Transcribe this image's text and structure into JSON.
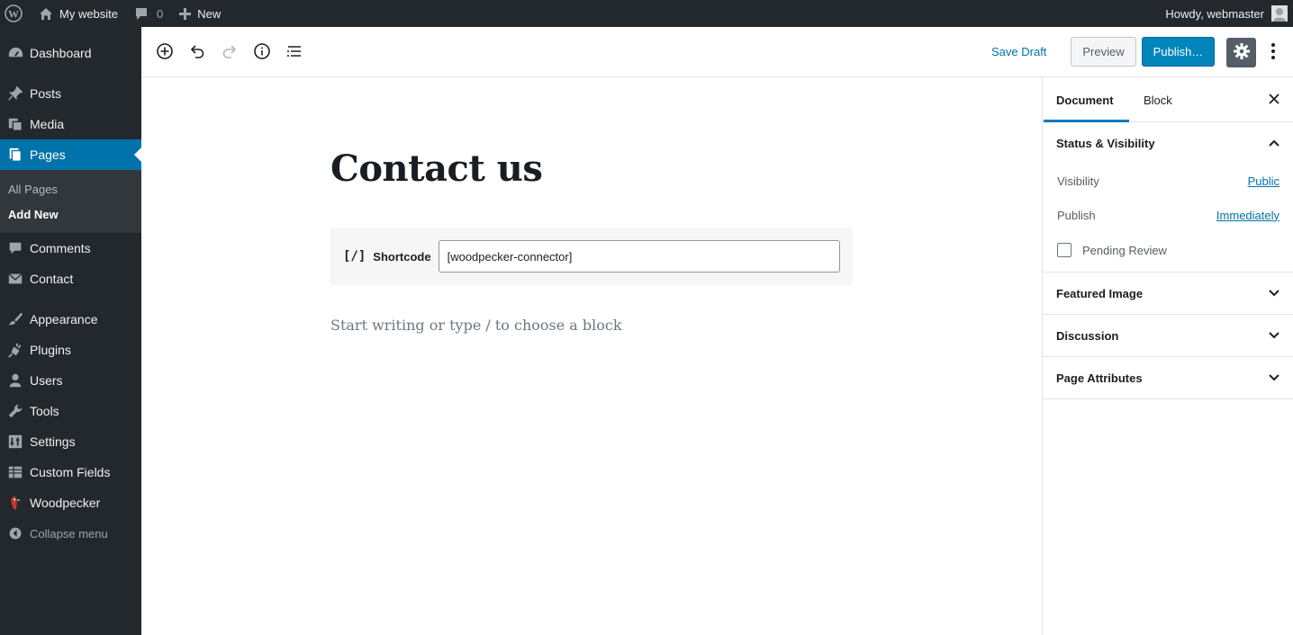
{
  "admin_bar": {
    "site_name": "My website",
    "comments_count": "0",
    "new_label": "New",
    "howdy": "Howdy, webmaster"
  },
  "admin_menu": {
    "items": [
      {
        "label": "Dashboard",
        "icon": "dashboard-icon"
      },
      {
        "label": "Posts",
        "icon": "pin-icon"
      },
      {
        "label": "Media",
        "icon": "media-icon"
      },
      {
        "label": "Pages",
        "icon": "pages-icon"
      },
      {
        "label": "Comments",
        "icon": "comment-icon"
      },
      {
        "label": "Contact",
        "icon": "envelope-icon"
      },
      {
        "label": "Appearance",
        "icon": "brush-icon"
      },
      {
        "label": "Plugins",
        "icon": "plug-icon"
      },
      {
        "label": "Users",
        "icon": "user-icon"
      },
      {
        "label": "Tools",
        "icon": "wrench-icon"
      },
      {
        "label": "Settings",
        "icon": "sliders-icon"
      },
      {
        "label": "Custom Fields",
        "icon": "table-icon"
      },
      {
        "label": "Woodpecker",
        "icon": "woodpecker-icon"
      }
    ],
    "submenu": [
      "All Pages",
      "Add New"
    ],
    "collapse_label": "Collapse menu"
  },
  "toolbar": {
    "save_draft": "Save Draft",
    "preview": "Preview",
    "publish": "Publish…"
  },
  "editor": {
    "title": "Contact us",
    "shortcode_icon": "[/]",
    "shortcode_label": "Shortcode",
    "shortcode_value": "[woodpecker-connector]",
    "placeholder": "Start writing or type / to choose a block"
  },
  "sidebar": {
    "tabs": [
      "Document",
      "Block"
    ],
    "status_visibility": {
      "title": "Status & Visibility",
      "visibility_label": "Visibility",
      "visibility_value": "Public",
      "publish_label": "Publish",
      "publish_value": "Immediately",
      "pending_review": "Pending Review"
    },
    "panels": [
      "Featured Image",
      "Discussion",
      "Page Attributes"
    ]
  },
  "colors": {
    "admin_dark": "#23282d",
    "admin_blue": "#0073aa",
    "publish_blue": "#0085ba"
  }
}
